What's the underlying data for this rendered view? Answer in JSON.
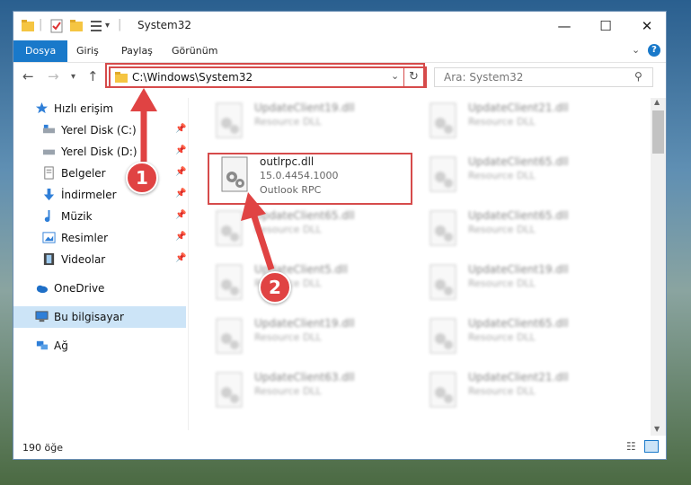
{
  "window": {
    "title": "System32"
  },
  "ribbon": {
    "tabs": [
      "Dosya",
      "Giriş",
      "Paylaş",
      "Görünüm"
    ]
  },
  "address": {
    "path": "C:\\Windows\\System32"
  },
  "search": {
    "placeholder": "Ara: System32"
  },
  "sidebar": {
    "quick_access": "Hızlı erişim",
    "items": [
      "Yerel Disk (C:)",
      "Yerel Disk (D:)",
      "Belgeler",
      "İndirmeler",
      "Müzik",
      "Resimler",
      "Videolar"
    ],
    "onedrive": "OneDrive",
    "this_pc": "Bu bilgisayar",
    "network": "Ağ"
  },
  "files": {
    "highlighted": {
      "name": "outlrpc.dll",
      "version": "15.0.4454.1000",
      "description": "Outlook RPC"
    },
    "col1": [
      {
        "name": "UpdateClient19.dll",
        "desc": "Resource DLL"
      },
      {
        "name": "UpdateClient65.dll",
        "desc": "Resource DLL"
      },
      {
        "name": "UpdateClient5.dll",
        "desc": "Resource DLL"
      },
      {
        "name": "UpdateClient19.dll",
        "desc": "Resource DLL"
      },
      {
        "name": "UpdateClient63.dll",
        "desc": "Resource DLL"
      }
    ],
    "col2": [
      {
        "name": "UpdateClient21.dll",
        "desc": "Resource DLL"
      },
      {
        "name": "UpdateClient65.dll",
        "desc": "Resource DLL"
      },
      {
        "name": "UpdateClient65.dll",
        "desc": "Resource DLL"
      },
      {
        "name": "UpdateClient19.dll",
        "desc": "Resource DLL"
      },
      {
        "name": "UpdateClient65.dll",
        "desc": "Resource DLL"
      },
      {
        "name": "UpdateClient21.dll",
        "desc": "Resource DLL"
      }
    ]
  },
  "status": {
    "count": "190 öğe"
  },
  "annotations": {
    "step1": "1",
    "step2": "2",
    "color": "#e04343"
  }
}
